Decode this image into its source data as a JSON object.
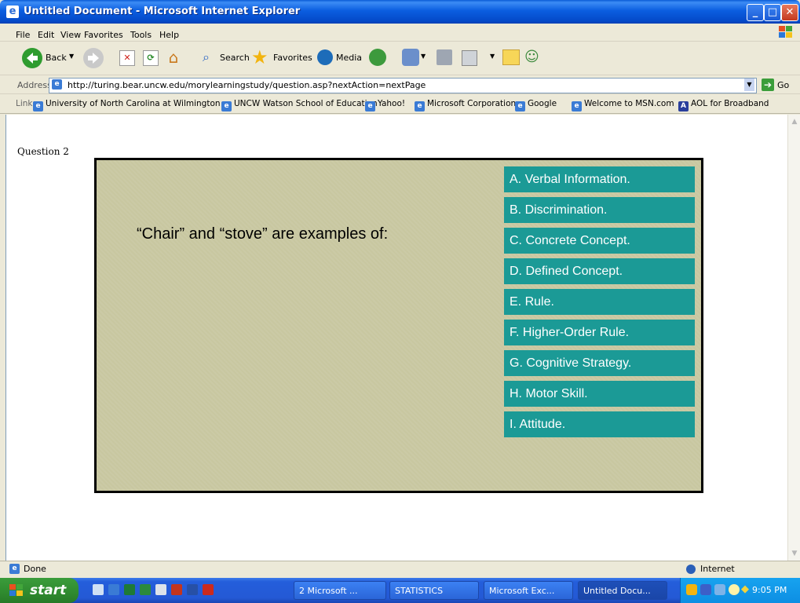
{
  "window": {
    "title": "Untitled Document - Microsoft Internet Explorer"
  },
  "menu": [
    "File",
    "Edit",
    "View",
    "Favorites",
    "Tools",
    "Help"
  ],
  "toolbar": {
    "back_label": "Back",
    "search_label": "Search",
    "favorites_label": "Favorites",
    "media_label": "Media"
  },
  "address": {
    "label": "Address",
    "url": "http://turing.bear.uncw.edu/morylearningstudy/question.asp?nextAction=nextPage",
    "go_label": "Go"
  },
  "links": {
    "label": "Links",
    "items": [
      "University of North Carolina at Wilmington",
      "UNCW Watson School of Education",
      "Yahoo!",
      "Microsoft Corporation",
      "Google",
      "Welcome to MSN.com",
      "AOL for Broadband"
    ]
  },
  "page": {
    "question_label": "Question 2",
    "question_text": "“Chair” and “stove” are examples of:",
    "answers": [
      "A. Verbal Information.",
      "B. Discrimination.",
      "C. Concrete Concept.",
      "D. Defined Concept.",
      "E. Rule.",
      "F. Higher-Order Rule.",
      "G. Cognitive Strategy.",
      "H. Motor Skill.",
      "I. Attitude."
    ],
    "answer_color": "#1b9a96",
    "slide_color": "#c8c7a0"
  },
  "status": {
    "text": "Done",
    "zone": "Internet"
  },
  "taskbar": {
    "start_label": "start",
    "tasks": [
      "2 Microsoft ...",
      "STATISTICS",
      "Microsoft Exc...",
      "Untitled Docu..."
    ],
    "clock": "9:05 PM"
  }
}
